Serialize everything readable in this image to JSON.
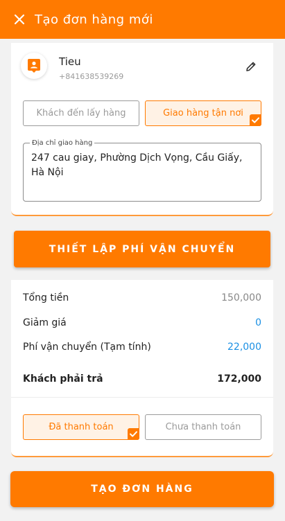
{
  "appbar": {
    "title": "Tạo đơn hàng mới",
    "close_icon": "close-icon"
  },
  "customer": {
    "name": "Tieu",
    "phone": "+841638539269",
    "avatar_icon": "contact-icon",
    "edit_icon": "pencil-icon"
  },
  "delivery": {
    "options": [
      {
        "label": "Khách đến lấy hàng",
        "selected": false
      },
      {
        "label": "Giao hàng tận nơi",
        "selected": true
      }
    ],
    "address_label": "Địa chỉ giao hàng",
    "address_value": "247 cau giay, Phường Dịch Vọng, Cầu Giấy, Hà Nội"
  },
  "shipping_button": "THIẾT LẬP PHÍ VẬN CHUYỂN",
  "summary": {
    "total_label": "Tổng tiền",
    "total_value": "150,000",
    "discount_label": "Giảm giá",
    "discount_value": "0",
    "shipping_label": "Phí vận chuyển (Tạm tính)",
    "shipping_value": "22,000",
    "pay_label": "Khách phải trả",
    "pay_value": "172,000"
  },
  "payment": {
    "options": [
      {
        "label": "Đã thanh toán",
        "selected": true
      },
      {
        "label": "Chưa thanh toán",
        "selected": false
      }
    ]
  },
  "create_button": "TẠO ĐƠN HÀNG",
  "colors": {
    "accent": "#ff7a00",
    "link_blue": "#1a8fe3",
    "background": "#f2f2f2"
  }
}
